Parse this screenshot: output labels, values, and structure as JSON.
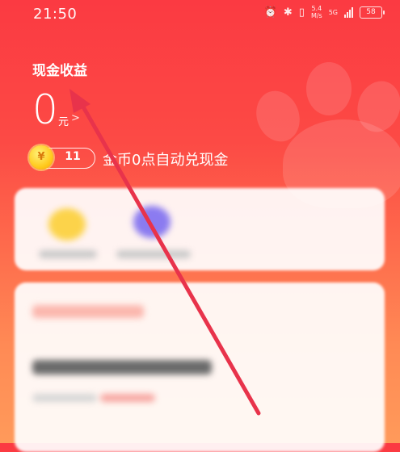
{
  "status_bar": {
    "time": "21:50",
    "net_speed_value": "5.4",
    "net_speed_unit": "M/s",
    "network_type": "5G",
    "battery": "58",
    "icons": [
      "alarm-icon",
      "bluetooth-icon",
      "vibrate-icon",
      "wifi-speed-icon",
      "signal-icon",
      "battery-icon"
    ]
  },
  "earnings": {
    "title": "现金收益",
    "amount": "0",
    "unit": "元",
    "chevron": ">"
  },
  "coins": {
    "icon_glyph": "¥",
    "count": "11",
    "note": "金币0点自动兑现金"
  },
  "colors": {
    "accent": "#fb3a42",
    "accent_bottom": "#ff9a5a",
    "annotation_arrow": "#e8334b",
    "coin_yellow": "#ffcb1f"
  },
  "annotation": {
    "type": "arrow",
    "points_to": "earn-amount"
  }
}
